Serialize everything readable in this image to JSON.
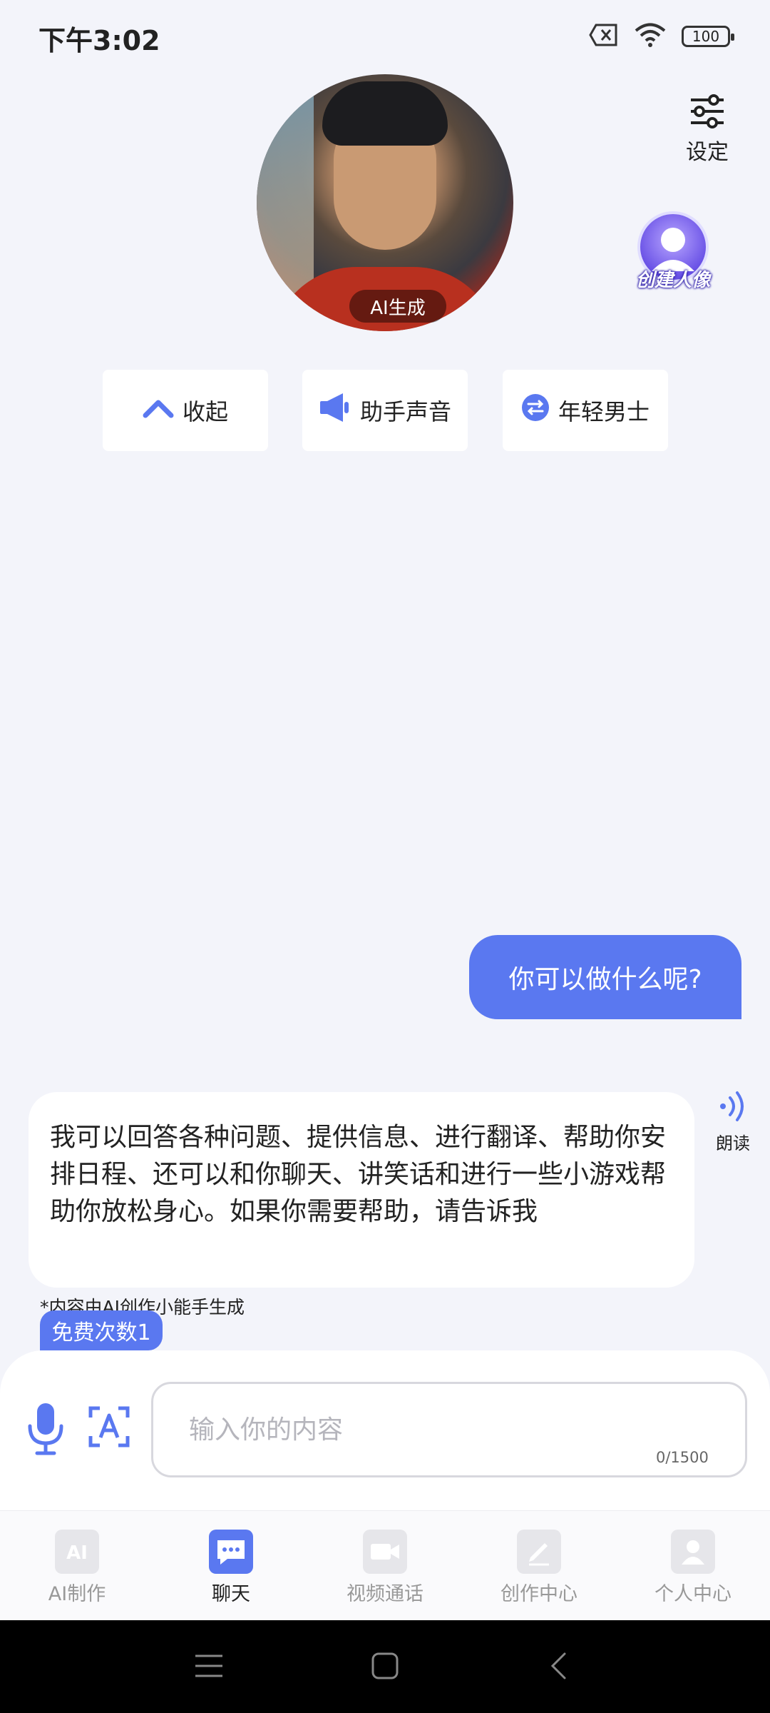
{
  "status_bar": {
    "time": "下午3:02",
    "battery": "100"
  },
  "avatar": {
    "label": "AI生成"
  },
  "settings": {
    "label": "设定",
    "icon": "sliders-icon"
  },
  "create_portrait": {
    "label": "创建人像"
  },
  "controls": {
    "collapse_label": "收起",
    "voice_label": "助手声音",
    "voice_type_label": "年轻男士"
  },
  "chat": {
    "user_message": "你可以做什么呢?",
    "bot_message": "我可以回答各种问题、提供信息、进行翻译、帮助你安排日程、还可以和你聊天、讲笑话和进行一些小游戏帮助你放松身心。如果你需要帮助，请告诉我",
    "read_label": "朗读",
    "ai_note": "*内容由AI创作小能手生成",
    "free_badge": "免费次数1"
  },
  "input": {
    "placeholder": "输入你的内容",
    "value": "",
    "char_count": "0/1500"
  },
  "tabs": [
    {
      "label": "AI制作",
      "icon": "ai-icon",
      "active": false
    },
    {
      "label": "聊天",
      "icon": "chat-icon",
      "active": true
    },
    {
      "label": "视频通话",
      "icon": "video-icon",
      "active": false
    },
    {
      "label": "创作中心",
      "icon": "edit-icon",
      "active": false
    },
    {
      "label": "个人中心",
      "icon": "person-icon",
      "active": false
    }
  ],
  "colors": {
    "accent": "#5a78f0",
    "background": "#f3f4fa"
  }
}
